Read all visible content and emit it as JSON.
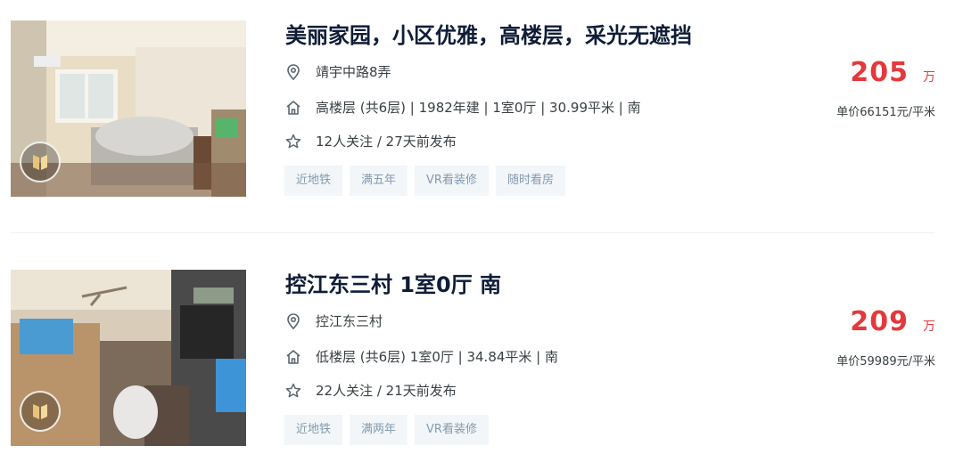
{
  "listings": [
    {
      "title": "美丽家园，小区优雅，高楼层，采光无遮挡",
      "location": "靖宇中路8弄",
      "house_info": "高楼层 (共6层) | 1982年建 | 1室0厅 | 30.99平米 | 南",
      "follow_info": "12人关注 / 27天前发布",
      "tags": [
        "近地铁",
        "满五年",
        "VR看装修",
        "随时看房"
      ],
      "total_price": "205",
      "price_unit": "万",
      "unit_price": "单价66151元/平米"
    },
    {
      "title": "控江东三村 1室0厅 南",
      "location": "控江东三村",
      "house_info": "低楼层 (共6层) 1室0厅 | 34.84平米 | 南",
      "follow_info": "22人关注 / 21天前发布",
      "tags": [
        "近地铁",
        "满两年",
        "VR看装修"
      ],
      "total_price": "209",
      "price_unit": "万",
      "unit_price": "单价59989元/平米"
    }
  ],
  "icons": {
    "location": "map-pin-icon",
    "house": "house-icon",
    "follow": "star-icon",
    "vr": "vr-view-icon"
  },
  "colors": {
    "price": "#e4393c",
    "title": "#101d37",
    "tag_bg": "#f2f6f9",
    "tag_text": "#849aae"
  }
}
